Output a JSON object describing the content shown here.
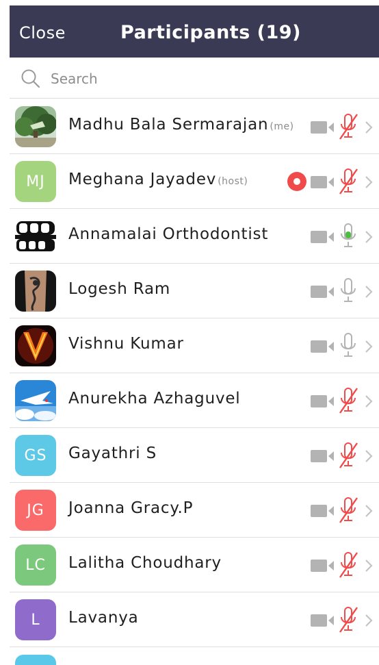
{
  "header": {
    "close_label": "Close",
    "title": "Participants (19)"
  },
  "search": {
    "placeholder": "Search"
  },
  "participants": [
    {
      "name": "Madhu Bala Sermarajan",
      "tag": "(me)",
      "avatar": "photo-tree",
      "video_icon": "camera-off-icon",
      "mic": "muted"
    },
    {
      "name": "Meghana Jayadev",
      "tag": "(host)",
      "avatar_initials": "MJ",
      "avatar_color": "#a4d47e",
      "recording": true,
      "video_icon": "camera-off-icon",
      "mic": "muted"
    },
    {
      "name": "Annamalai Orthodontist",
      "tag": "",
      "avatar": "photo-braces",
      "video_icon": "camera-off-icon",
      "mic": "active"
    },
    {
      "name": "Logesh Ram",
      "tag": "",
      "avatar": "photo-tattoo",
      "video_icon": "camera-off-icon",
      "mic": "unmuted"
    },
    {
      "name": "Vishnu Kumar",
      "tag": "",
      "avatar": "photo-fire-v",
      "video_icon": "camera-off-icon",
      "mic": "unmuted"
    },
    {
      "name": "Anurekha Azhaguvel",
      "tag": "",
      "avatar": "photo-sky-bird",
      "video_icon": "camera-off-icon",
      "mic": "muted"
    },
    {
      "name": "Gayathri S",
      "tag": "",
      "avatar_initials": "GS",
      "avatar_color": "#5dc9e6",
      "video_icon": "camera-off-icon",
      "mic": "muted"
    },
    {
      "name": "Joanna Gracy.P",
      "tag": "",
      "avatar_initials": "JG",
      "avatar_color": "#fb6a6a",
      "video_icon": "camera-off-icon",
      "mic": "muted"
    },
    {
      "name": "Lalitha Choudhary",
      "tag": "",
      "avatar_initials": "LC",
      "avatar_color": "#7cc97d",
      "video_icon": "camera-off-icon",
      "mic": "muted"
    },
    {
      "name": "Lavanya",
      "tag": "",
      "avatar_initials": "L",
      "avatar_color": "#8f6ccb",
      "video_icon": "camera-off-icon",
      "mic": "muted"
    }
  ],
  "colors": {
    "header_bg": "#3a3a55",
    "muted_red": "#f04b4b",
    "active_green": "#4cbd3e",
    "icon_gray": "#b3b3b3",
    "recording_red": "#f04b4b"
  }
}
